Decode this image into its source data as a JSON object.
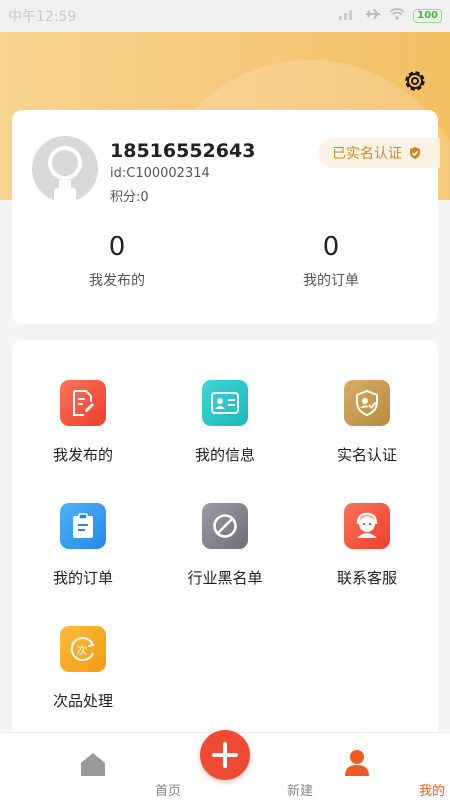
{
  "status_bar": {
    "time": "中午12:59",
    "battery": "100"
  },
  "header": {
    "settings_icon": "gear-icon"
  },
  "profile": {
    "phone": "18516552643",
    "id": "id:C100002314",
    "points": "积分:0",
    "verified_label": "已实名认证",
    "stats": [
      {
        "value": "0",
        "label": "我发布的"
      },
      {
        "value": "0",
        "label": "我的订单"
      }
    ]
  },
  "menu": {
    "items": [
      {
        "label": "我发布的",
        "icon": "edit-doc-icon",
        "color": "#f25a3c"
      },
      {
        "label": "我的信息",
        "icon": "id-card-icon",
        "color": "#2bc7c9"
      },
      {
        "label": "实名认证",
        "icon": "shield-check-icon",
        "color": "#c69a4e"
      },
      {
        "label": "我的订单",
        "icon": "clipboard-icon",
        "color": "#2e97f0"
      },
      {
        "label": "行业黑名单",
        "icon": "ban-icon",
        "color": "#8a8a94"
      },
      {
        "label": "联系客服",
        "icon": "customer-service-icon",
        "color": "#f25a3c"
      },
      {
        "label": "次品处理",
        "icon": "defect-refresh-icon",
        "color": "#f6a623"
      }
    ]
  },
  "tabbar": {
    "tabs": [
      {
        "label": "首页",
        "icon": "home-icon"
      },
      {
        "label": "新建",
        "icon": "plus-icon"
      },
      {
        "label": "我的",
        "icon": "user-icon"
      }
    ],
    "active_color": "#f05a24"
  }
}
